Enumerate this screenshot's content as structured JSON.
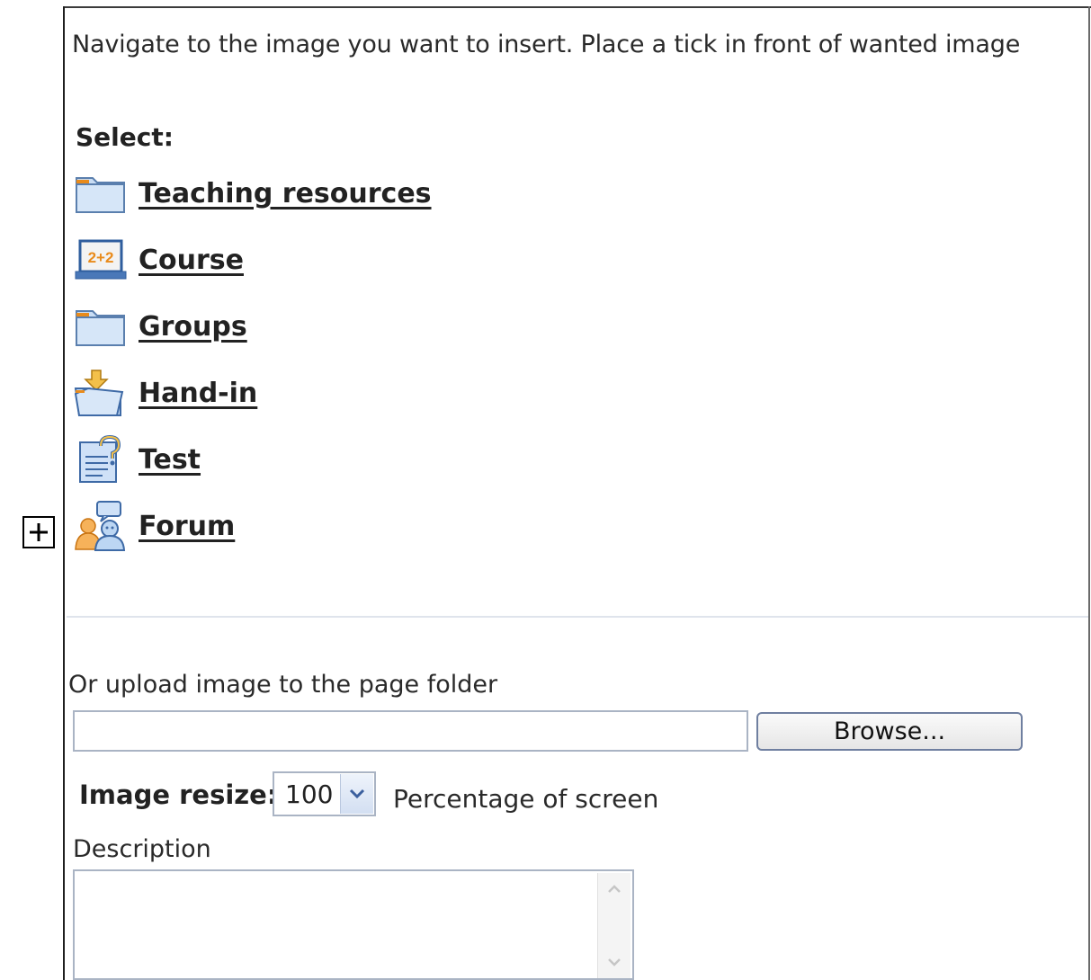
{
  "instruction": "Navigate to the image you want to insert. Place a tick in front of wanted image",
  "select_label": "Select:",
  "items": [
    {
      "label": "Teaching resources",
      "icon": "folder-icon"
    },
    {
      "label": "Course",
      "icon": "course-icon"
    },
    {
      "label": "Groups",
      "icon": "folder-icon"
    },
    {
      "label": "Hand-in",
      "icon": "hand-in-icon"
    },
    {
      "label": "Test",
      "icon": "test-icon"
    },
    {
      "label": "Forum",
      "icon": "forum-icon"
    }
  ],
  "course_icon_text": "2+2",
  "upload": {
    "label": "Or upload image to the page folder",
    "file_value": "",
    "browse_label": "Browse..."
  },
  "resize": {
    "label": "Image resize:",
    "value": "100",
    "hint": "Percentage of screen"
  },
  "description": {
    "label": "Description",
    "value": ""
  },
  "colors": {
    "folder": "#bcd6f3",
    "folder_stroke": "#5a7fae",
    "accent_orange": "#e98b1b",
    "border": "#aab4c4"
  }
}
